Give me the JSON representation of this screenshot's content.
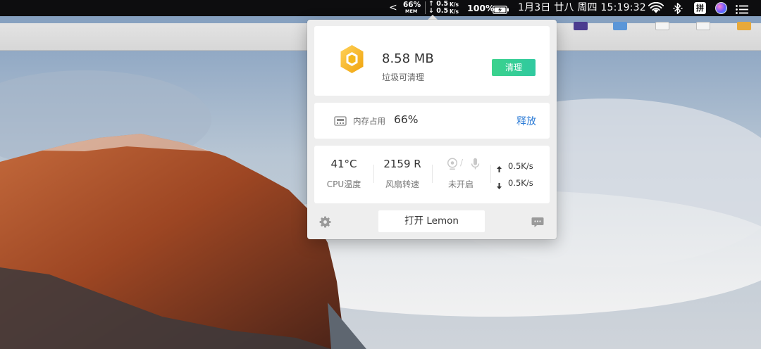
{
  "menubar": {
    "chevron": "<",
    "memory_percent": "66%",
    "memory_tag": "MEM",
    "net_up": "↑ 0.5",
    "net_up_unit": "K/s",
    "net_down": "↓ 0.5",
    "net_down_unit": "K/s",
    "battery_percent": "100%",
    "clock": "1月3日 廿八 周四 15:19:32",
    "input_method_glyph": "拼"
  },
  "popover": {
    "trash": {
      "size": "8.58 MB",
      "caption": "垃圾可清理",
      "clean_label": "清理"
    },
    "memory": {
      "label": "内存占用",
      "value": "66%",
      "release_label": "释放"
    },
    "stats": {
      "cpu_temp": "41°C",
      "cpu_label": "CPU温度",
      "fan_speed": "2159 R",
      "fan_label": "风扇转速",
      "camera_mic_separator": "/",
      "camera_mic_status": "未开启",
      "upload_speed": "0.5K/s",
      "download_speed": "0.5K/s"
    },
    "open_label": "打开 Lemon"
  },
  "colors": {
    "clean_button": "#3bd28c",
    "release_link": "#2c7bd6",
    "hexagon": "#f5b81c",
    "menubar": "#0d0d0f"
  },
  "icons": [
    "wifi-icon",
    "bluetooth-icon",
    "siri-icon",
    "notification-center-icon",
    "battery-icon",
    "gear-icon",
    "feedback-icon",
    "memory-chip-icon",
    "camera-icon",
    "microphone-icon",
    "arrow-up-icon",
    "arrow-down-icon"
  ]
}
